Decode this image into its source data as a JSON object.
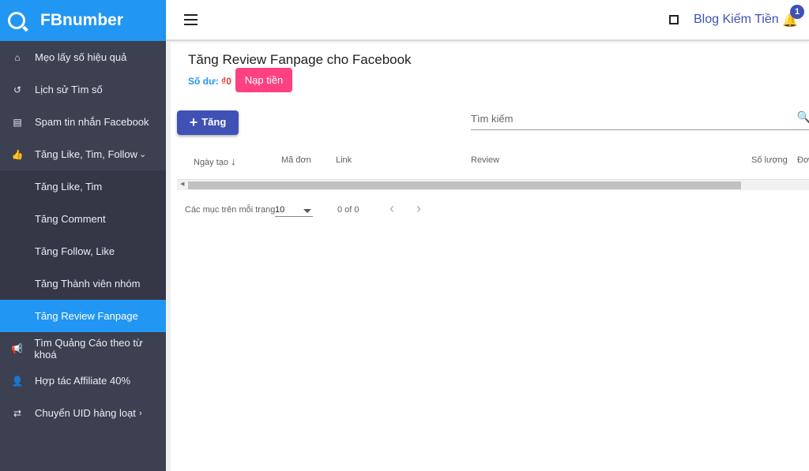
{
  "brand": {
    "name": "FBnumber"
  },
  "sidebar": {
    "items": [
      {
        "label": "Mẹo lấy số hiệu quả",
        "icon": "home-icon"
      },
      {
        "label": "Lịch sử Tìm số",
        "icon": "history-icon"
      },
      {
        "label": "Spam tin nhắn Facebook",
        "icon": "message-icon"
      },
      {
        "label": "Tăng Like, Tim, Follow",
        "icon": "thumb-up-icon"
      },
      {
        "label": "Tìm Quảng Cáo theo từ khoá",
        "icon": "megaphone-icon"
      },
      {
        "label": "Hợp tác Affiliate 40%",
        "icon": "person-add-icon"
      },
      {
        "label": "Chuyển UID hàng loạt",
        "icon": "swap-icon"
      }
    ],
    "submenu": [
      {
        "label": "Tăng Like, Tim"
      },
      {
        "label": "Tăng Comment"
      },
      {
        "label": "Tăng Follow, Like"
      },
      {
        "label": "Tăng Thành viên nhóm"
      },
      {
        "label": "Tăng Review Fanpage",
        "active": true
      }
    ]
  },
  "topbar": {
    "blog": "Blog Kiếm Tiền",
    "notifications": "1"
  },
  "page": {
    "title": "Tăng Review Fanpage cho Facebook",
    "balance_label": "Số dư: ",
    "balance_value": "₫0",
    "topup": "Nạp tiền",
    "add": "Tăng",
    "search_placeholder": "Tìm kiếm"
  },
  "table": {
    "headers": [
      "Ngày tạo",
      "Mã đơn",
      "Link",
      "Review",
      "Số lượng",
      "Đơn"
    ]
  },
  "pagination": {
    "label": "Các mục trên mỗi trang",
    "per_page": "10",
    "range": "0 of 0"
  },
  "colors": {
    "primary": "#2196f3",
    "accent": "#ff4081",
    "indigo": "#3f51b5",
    "sidebar": "#3c4050"
  }
}
